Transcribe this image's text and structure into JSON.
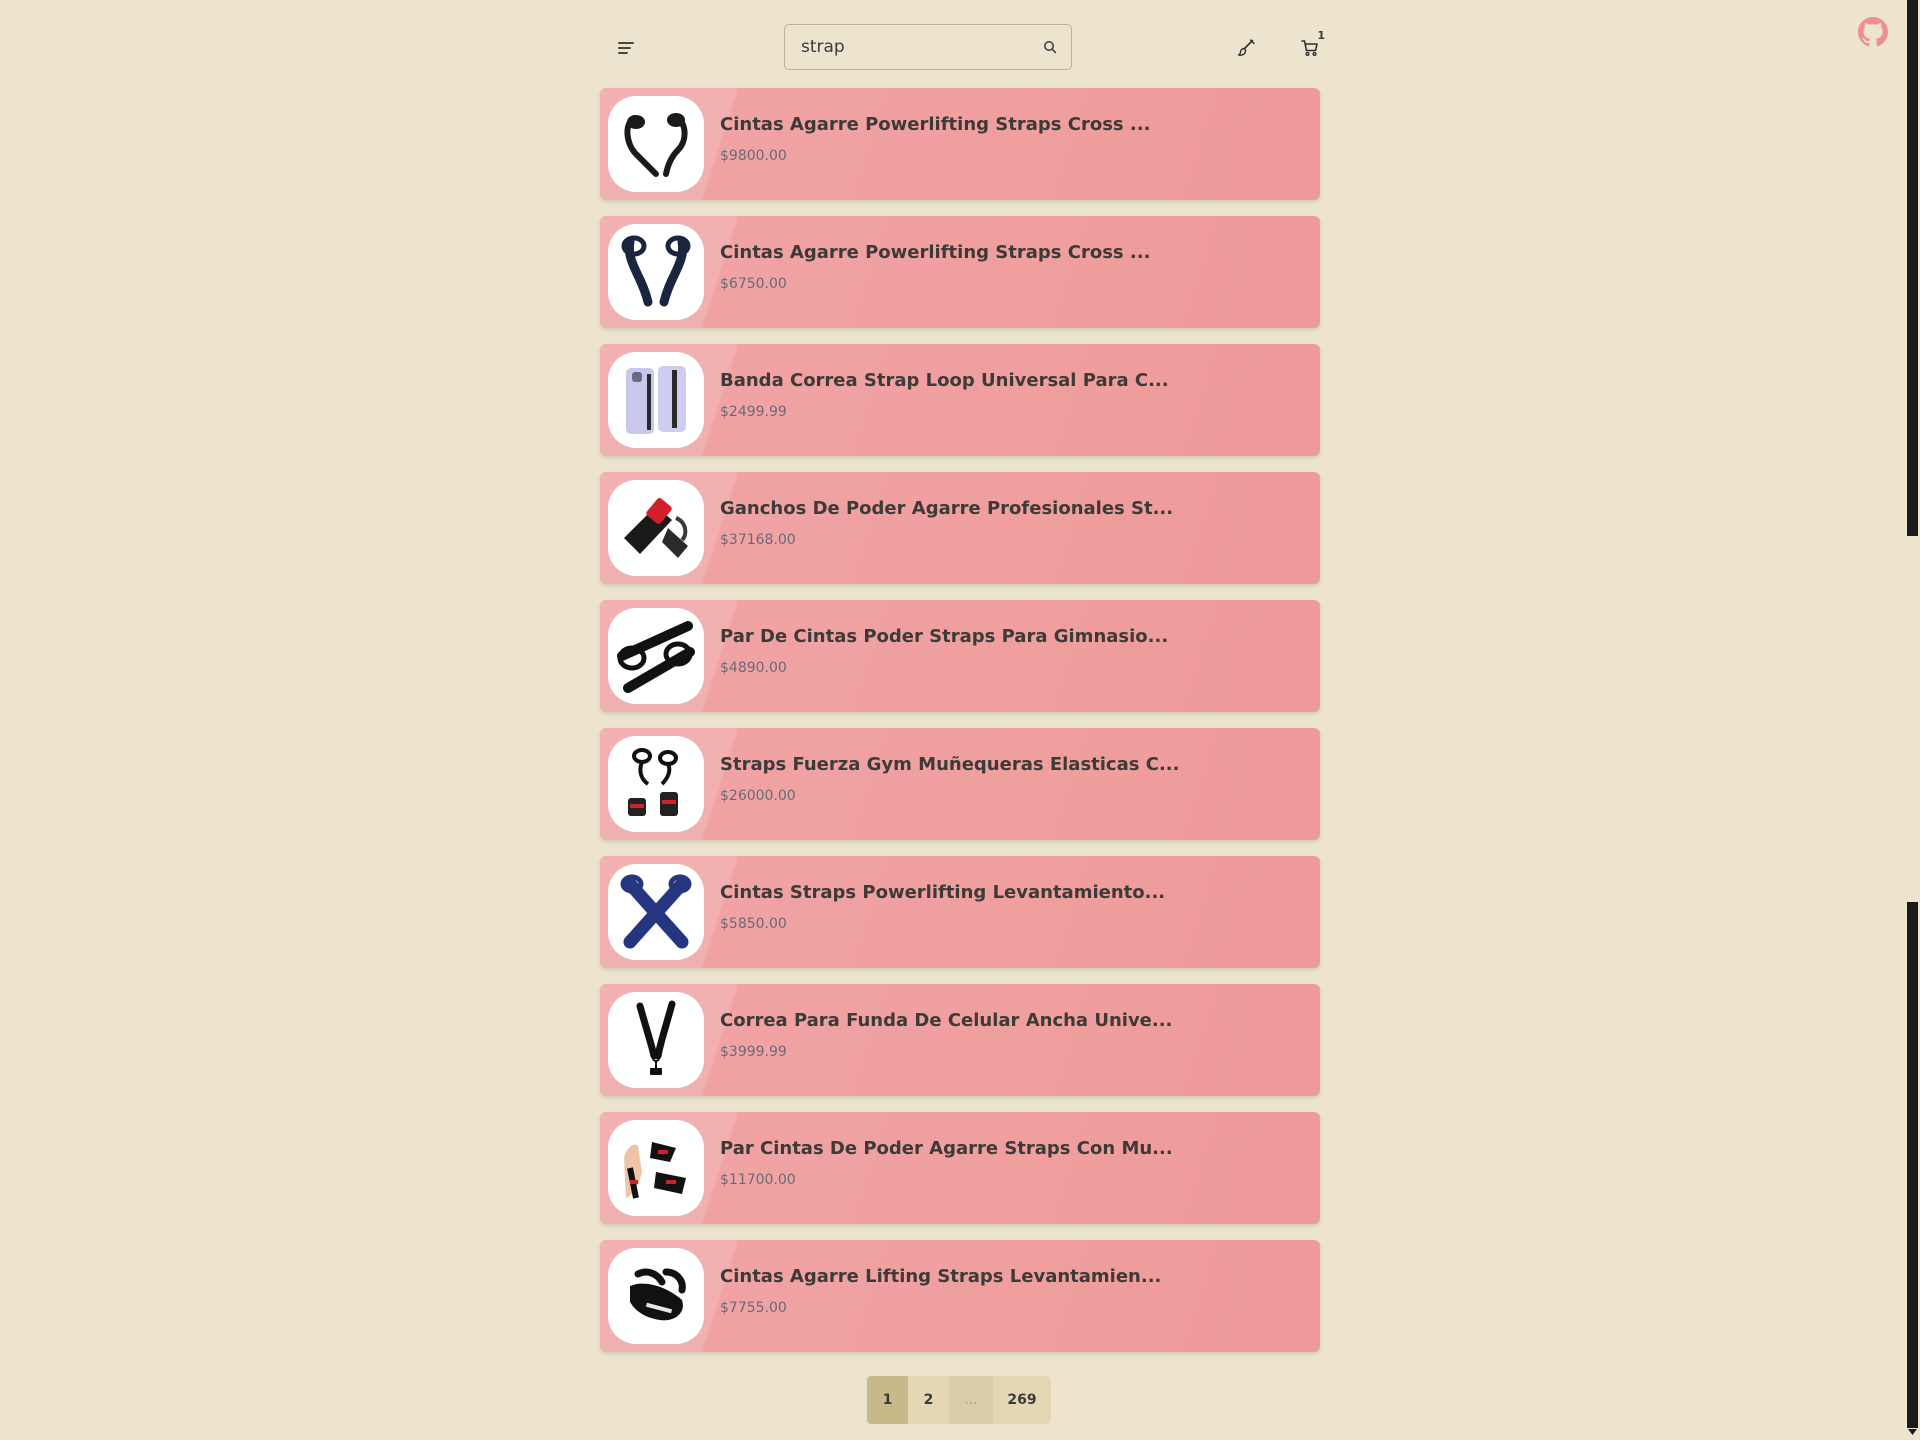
{
  "search": {
    "value": "strap",
    "placeholder": "Search"
  },
  "header": {
    "menu_icon": "menu-icon",
    "search_icon": "search-icon",
    "theme_icon": "paintbrush-icon",
    "cart_icon": "cart-icon",
    "cart_count": "1",
    "github_icon": "github-icon"
  },
  "colors": {
    "background": "#ede4cd",
    "card": "#f1a3a3",
    "pagination_active": "#c8b98a",
    "pagination": "#e4d8b4"
  },
  "products": [
    {
      "name": "Cintas Agarre Powerlifting Straps Cross ...",
      "price": "$9800.00",
      "image": "black lifting straps"
    },
    {
      "name": "Cintas Agarre Powerlifting Straps Cross ...",
      "price": "$6750.00",
      "image": "navy lifting straps"
    },
    {
      "name": "Banda Correa Strap Loop Universal Para C...",
      "price": "$2499.99",
      "image": "phone with strap"
    },
    {
      "name": "Ganchos De Poder Agarre Profesionales St...",
      "price": "$37168.00",
      "image": "lifting hooks"
    },
    {
      "name": "Par De Cintas Poder Straps Para Gimnasio...",
      "price": "$4890.00",
      "image": "black gym straps"
    },
    {
      "name": "Straps Fuerza Gym Muñequeras Elasticas C...",
      "price": "$26000.00",
      "image": "straps and wrist wraps"
    },
    {
      "name": "Cintas Straps Powerlifting Levantamiento...",
      "price": "$5850.00",
      "image": "blue crossed straps"
    },
    {
      "name": "Correa Para Funda De Celular Ancha Unive...",
      "price": "$3999.99",
      "image": "phone lanyard"
    },
    {
      "name": "Par Cintas De Poder Agarre Straps Con Mu...",
      "price": "$11700.00",
      "image": "straps with wrist support"
    },
    {
      "name": "Cintas Agarre Lifting Straps Levantamien...",
      "price": "$7755.00",
      "image": "black lifting straps"
    }
  ],
  "pagination": {
    "pages": [
      "1",
      "2",
      "...",
      "269"
    ],
    "current": "1"
  }
}
